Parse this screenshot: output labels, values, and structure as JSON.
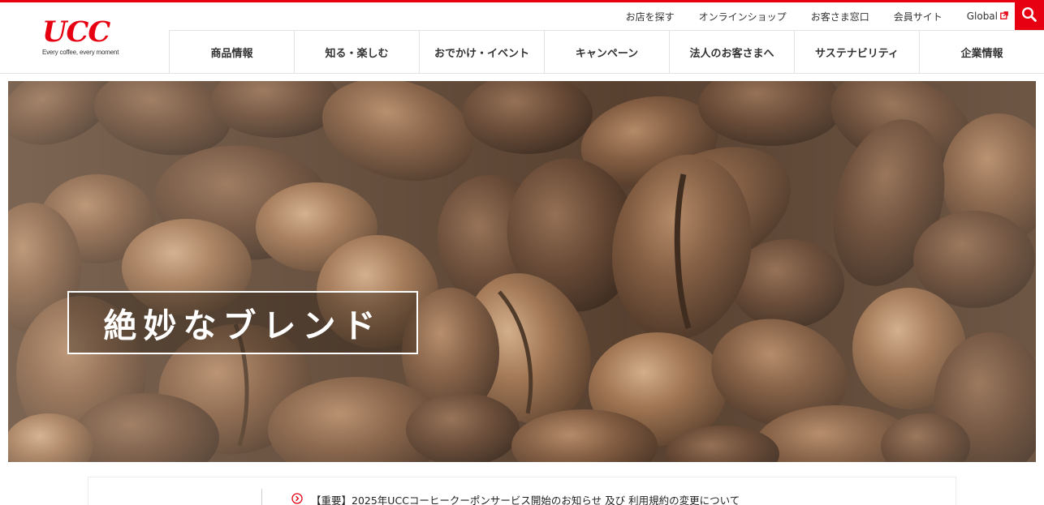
{
  "brand": {
    "logo_text": "UCC",
    "tagline": "Every coffee, every moment",
    "accent_color": "#e60012"
  },
  "utility_nav": [
    {
      "label": "お店を探す"
    },
    {
      "label": "オンラインショップ"
    },
    {
      "label": "お客さま窓口"
    },
    {
      "label": "会員サイト"
    },
    {
      "label": "Global",
      "icon": "external-link-icon"
    }
  ],
  "search": {
    "icon": "search-icon"
  },
  "main_nav": [
    {
      "label": "商品情報"
    },
    {
      "label": "知る・楽しむ"
    },
    {
      "label": "おでかけ・イベント"
    },
    {
      "label": "キャンペーン"
    },
    {
      "label": "法人のお客さまへ"
    },
    {
      "label": "サステナビリティ"
    },
    {
      "label": "企業情報"
    }
  ],
  "hero": {
    "caption": "絶妙なブレンド",
    "image": "coffee-beans-photo"
  },
  "news": {
    "icon": "arrow-circle-right-icon",
    "text": "【重要】2025年UCCコーヒークーポンサービス開始のお知らせ 及び 利用規約の変更について"
  }
}
